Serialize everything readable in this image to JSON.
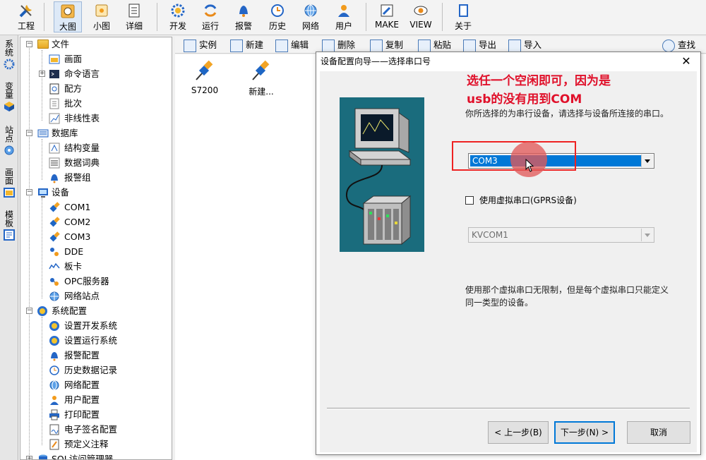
{
  "toolbar": {
    "buttons": [
      {
        "label": "工程",
        "icon": "tools-icon"
      },
      {
        "label": "大图",
        "icon": "large-icon-view-icon",
        "active": true
      },
      {
        "label": "小图",
        "icon": "small-icon-view-icon"
      },
      {
        "label": "详细",
        "icon": "details-view-icon"
      },
      {
        "label": "开发",
        "icon": "develop-gear-icon"
      },
      {
        "label": "运行",
        "icon": "run-icon"
      },
      {
        "label": "报警",
        "icon": "alarm-bell-icon"
      },
      {
        "label": "历史",
        "icon": "history-clock-icon"
      },
      {
        "label": "网络",
        "icon": "network-globe-icon"
      },
      {
        "label": "用户",
        "icon": "user-icon"
      },
      {
        "label": "MAKE",
        "icon": "make-pencil-icon"
      },
      {
        "label": "VIEW",
        "icon": "view-eye-icon"
      },
      {
        "label": "关于",
        "icon": "about-book-icon"
      }
    ]
  },
  "vtabs": [
    "系统",
    "变量",
    "站点",
    "画面",
    "模板"
  ],
  "tree": {
    "file": {
      "label": "文件",
      "children": [
        "画面",
        "命令语言",
        "配方",
        "批次",
        "非线性表"
      ]
    },
    "database": {
      "label": "数据库",
      "children": [
        "结构变量",
        "数据词典",
        "报警组"
      ]
    },
    "device": {
      "label": "设备",
      "children": [
        "COM1",
        "COM2",
        "COM3",
        "DDE",
        "板卡",
        "OPC服务器",
        "网络站点"
      ]
    },
    "sysconfig": {
      "label": "系统配置",
      "children": [
        "设置开发系统",
        "设置运行系统",
        "报警配置",
        "历史数据记录",
        "网络配置",
        "用户配置",
        "打印配置",
        "电子签名配置",
        "预定义注释"
      ]
    },
    "sql": {
      "label": "SQL访问管理器"
    }
  },
  "subbar": [
    "实例",
    "新建",
    "编辑",
    "删除",
    "复制",
    "粘贴",
    "导出",
    "导入",
    "查找"
  ],
  "devices": [
    "S7200",
    "新建..."
  ],
  "dialog": {
    "title": "设备配置向导——选择串口号",
    "close": "✕",
    "annotation_line1": "选任一个空闲即可，因为是",
    "annotation_line2": "usb的没有用到COM",
    "hint_select_port": "你所选择的为串行设备，请选择与设备所连接的串口。",
    "port_value": "COM3",
    "virtual_port_label": "使用虚拟串口(GPRS设备)",
    "virtual_port_checked": false,
    "virtual_port_value": "KVCOM1",
    "hint_virtual": "使用那个虚拟串口无限制，但是每个虚拟串口只能定义同一类型的设备。",
    "prev_button": "< 上一步(B)",
    "next_button": "下一步(N) >",
    "cancel_button": "取消"
  },
  "colors": {
    "accent": "#0078d7",
    "annotation": "#e0102a",
    "illustration_bg": "#1a6c7d"
  }
}
